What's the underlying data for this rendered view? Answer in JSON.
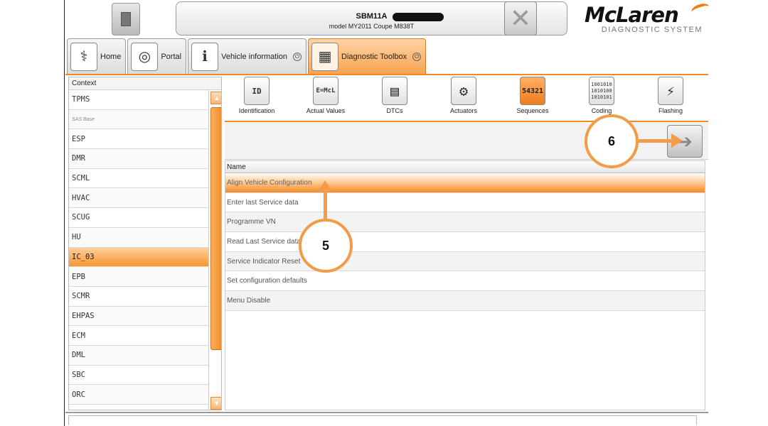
{
  "header": {
    "vin": "SBM11A",
    "model": "model MY2011 Coupe M838T",
    "logo_text": "McLaren",
    "logo_subtitle": "DIAGNOSTIC SYSTEM"
  },
  "tabs": [
    {
      "label": "Home",
      "icon": "stethoscope-icon"
    },
    {
      "label": "Portal",
      "icon": "spiral-icon"
    },
    {
      "label": "Vehicle information",
      "icon": "car-info-icon"
    },
    {
      "label": "Diagnostic Toolbox",
      "icon": "toolbox-icon",
      "active": true
    }
  ],
  "context": {
    "header": "Context",
    "items": [
      "TPMS",
      "SAS Base",
      "ESP",
      "DMR",
      "SCML",
      "HVAC",
      "SCUG",
      "HU",
      "IC_03",
      "EPB",
      "SCMR",
      "EHPAS",
      "ECM",
      "DML",
      "SBC",
      "ORC"
    ],
    "selected": "IC_03"
  },
  "toolbox": [
    {
      "label": "Identification",
      "glyph": "ID"
    },
    {
      "label": "Actual Values",
      "glyph": "E=McL"
    },
    {
      "label": "DTCs",
      "glyph": "▤"
    },
    {
      "label": "Actuators",
      "glyph": "⚙"
    },
    {
      "label": "Sequences",
      "glyph": "54321",
      "active": true
    },
    {
      "label": "Coding",
      "glyph": "1001010\n1010100\n1010101"
    },
    {
      "label": "Flashing",
      "glyph": "⚡"
    }
  ],
  "sequences": {
    "column": "Name",
    "rows": [
      "Align Vehicle Configuration",
      "Enter last Service data",
      "Programme VN",
      "Read Last Service data",
      "Service Indicator Reset",
      "Set configuration defaults",
      "Menu Disable"
    ],
    "selected": "Align Vehicle Configuration"
  },
  "annotations": {
    "step5": "5",
    "step6": "6"
  },
  "colors": {
    "accent": "#f08a25",
    "callout": "#f29b48"
  }
}
